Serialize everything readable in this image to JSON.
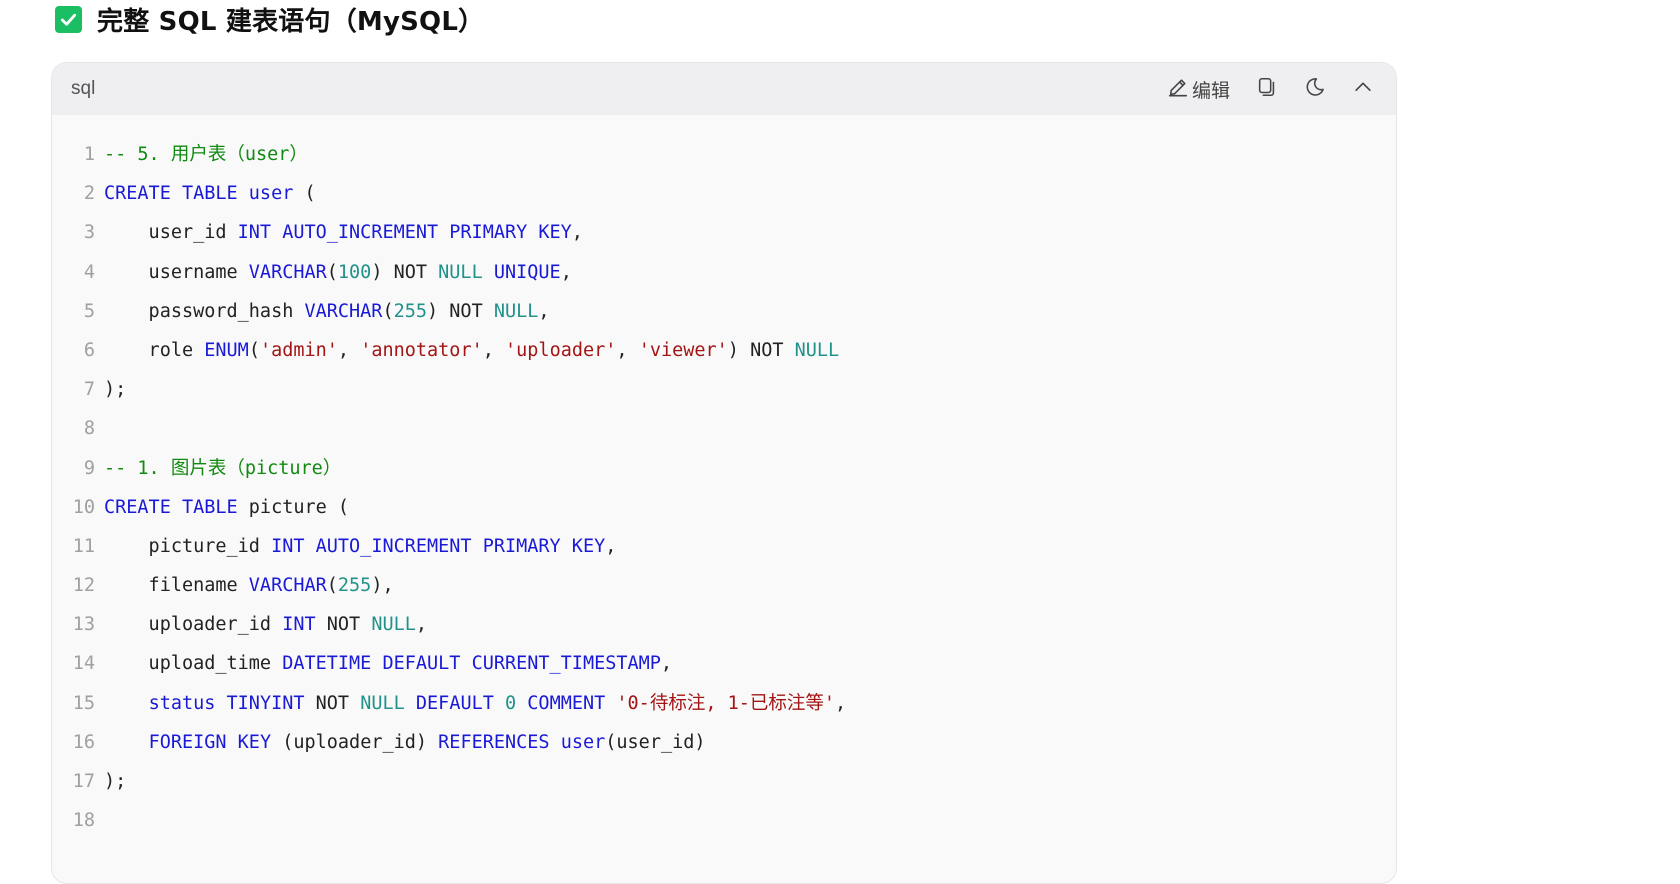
{
  "heading": {
    "title": "完整 SQL 建表语句（MySQL）",
    "icon": "check-square-icon",
    "icon_color": "#1bbf63"
  },
  "code_block": {
    "language": "sql",
    "toolbar": {
      "edit_label": "编辑",
      "edit_icon": "pencil-icon",
      "copy_icon": "copy-icon",
      "theme_icon": "moon-icon",
      "collapse_icon": "chevron-up-icon"
    },
    "colors": {
      "keyword": "#1a1ad6",
      "number": "#21928a",
      "string": "#a31515",
      "comment": "#108a10",
      "line_number": "#a0a0a0",
      "header_bg": "#efeff2",
      "body_bg": "#f9f9f9"
    },
    "lines": [
      {
        "n": "1",
        "tokens": [
          [
            "cm",
            "-- 5. 用户表（user）"
          ]
        ]
      },
      {
        "n": "2",
        "tokens": [
          [
            "kw",
            "CREATE TABLE user"
          ],
          [
            "pl",
            " ("
          ]
        ]
      },
      {
        "n": "3",
        "tokens": [
          [
            "pl",
            "    user_id "
          ],
          [
            "kw",
            "INT AUTO_INCREMENT PRIMARY KEY"
          ],
          [
            "pl",
            ","
          ]
        ]
      },
      {
        "n": "4",
        "tokens": [
          [
            "pl",
            "    username "
          ],
          [
            "kw",
            "VARCHAR"
          ],
          [
            "pl",
            "("
          ],
          [
            "num",
            "100"
          ],
          [
            "pl",
            ") NOT "
          ],
          [
            "num",
            "NULL"
          ],
          [
            "pl",
            " "
          ],
          [
            "kw",
            "UNIQUE"
          ],
          [
            "pl",
            ","
          ]
        ]
      },
      {
        "n": "5",
        "tokens": [
          [
            "pl",
            "    password_hash "
          ],
          [
            "kw",
            "VARCHAR"
          ],
          [
            "pl",
            "("
          ],
          [
            "num",
            "255"
          ],
          [
            "pl",
            ") NOT "
          ],
          [
            "num",
            "NULL"
          ],
          [
            "pl",
            ","
          ]
        ]
      },
      {
        "n": "6",
        "tokens": [
          [
            "pl",
            "    role "
          ],
          [
            "kw",
            "ENUM"
          ],
          [
            "pl",
            "("
          ],
          [
            "str",
            "'admin'"
          ],
          [
            "pl",
            ", "
          ],
          [
            "str",
            "'annotator'"
          ],
          [
            "pl",
            ", "
          ],
          [
            "str",
            "'uploader'"
          ],
          [
            "pl",
            ", "
          ],
          [
            "str",
            "'viewer'"
          ],
          [
            "pl",
            ") NOT "
          ],
          [
            "num",
            "NULL"
          ]
        ]
      },
      {
        "n": "7",
        "tokens": [
          [
            "pl",
            ");"
          ]
        ]
      },
      {
        "n": "8",
        "tokens": []
      },
      {
        "n": "9",
        "tokens": [
          [
            "cm",
            "-- 1. 图片表（picture）"
          ]
        ]
      },
      {
        "n": "10",
        "tokens": [
          [
            "kw",
            "CREATE TABLE"
          ],
          [
            "pl",
            " picture ("
          ]
        ]
      },
      {
        "n": "11",
        "tokens": [
          [
            "pl",
            "    picture_id "
          ],
          [
            "kw",
            "INT AUTO_INCREMENT PRIMARY KEY"
          ],
          [
            "pl",
            ","
          ]
        ]
      },
      {
        "n": "12",
        "tokens": [
          [
            "pl",
            "    filename "
          ],
          [
            "kw",
            "VARCHAR"
          ],
          [
            "pl",
            "("
          ],
          [
            "num",
            "255"
          ],
          [
            "pl",
            "),"
          ]
        ]
      },
      {
        "n": "13",
        "tokens": [
          [
            "pl",
            "    uploader_id "
          ],
          [
            "kw",
            "INT"
          ],
          [
            "pl",
            " NOT "
          ],
          [
            "num",
            "NULL"
          ],
          [
            "pl",
            ","
          ]
        ]
      },
      {
        "n": "14",
        "tokens": [
          [
            "pl",
            "    upload_time "
          ],
          [
            "kw",
            "DATETIME DEFAULT CURRENT_TIMESTAMP"
          ],
          [
            "pl",
            ","
          ]
        ]
      },
      {
        "n": "15",
        "tokens": [
          [
            "pl",
            "    "
          ],
          [
            "kw",
            "status TINYINT"
          ],
          [
            "pl",
            " NOT "
          ],
          [
            "num",
            "NULL"
          ],
          [
            "pl",
            " "
          ],
          [
            "kw",
            "DEFAULT"
          ],
          [
            "pl",
            " "
          ],
          [
            "num",
            "0"
          ],
          [
            "pl",
            " "
          ],
          [
            "kw",
            "COMMENT"
          ],
          [
            "pl",
            " "
          ],
          [
            "str",
            "'0-待标注, 1-已标注等'"
          ],
          [
            "pl",
            ","
          ]
        ]
      },
      {
        "n": "16",
        "tokens": [
          [
            "pl",
            "    "
          ],
          [
            "kw",
            "FOREIGN KEY"
          ],
          [
            "pl",
            " (uploader_id) "
          ],
          [
            "kw",
            "REFERENCES"
          ],
          [
            "pl",
            " "
          ],
          [
            "kw",
            "user"
          ],
          [
            "pl",
            "(user_id)"
          ]
        ]
      },
      {
        "n": "17",
        "tokens": [
          [
            "pl",
            ");"
          ]
        ]
      },
      {
        "n": "18",
        "tokens": []
      }
    ]
  }
}
